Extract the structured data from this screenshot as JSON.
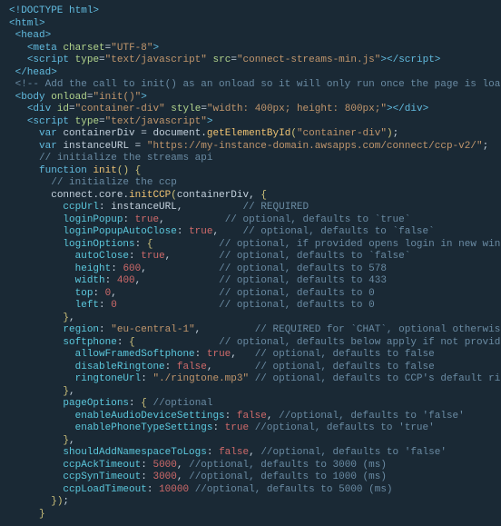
{
  "colors": {
    "bg": "#1a2935",
    "kw": "#62bce0",
    "attr": "#b2d48c",
    "str": "#c1966c",
    "val": "#cf6a6a",
    "fn": "#f0c373",
    "cmt": "#6a8ba3",
    "prop": "#5cc9de",
    "br": "#cdc17a",
    "plain": "#c5d2de"
  },
  "code": {
    "doctype": "<!DOCTYPE html>",
    "html_open": "<html>",
    "head_open": "<head>",
    "meta": {
      "charset": "UTF-8"
    },
    "script_ext": {
      "type": "text/javascript",
      "src": "connect-streams-min.js"
    },
    "head_close": "</head>",
    "add_call_comment": "<!-- Add the call to init() as an onload so it will only run once the page is loaded -->",
    "body_onload": "init()",
    "div": {
      "id": "container-div",
      "style": "width: 400px; height: 800px;"
    },
    "script_inline_type": "text/javascript",
    "var1": {
      "name": "containerDiv",
      "expr": "document.getElementById(\"container-div\");"
    },
    "var2": {
      "name": "instanceURL",
      "value": "\"https://my-instance-domain.awsapps.com/connect/ccp-v2/\""
    },
    "comment_streams": "// initialize the streams api",
    "fn_name": "init",
    "comment_ccp": "// initialize the ccp",
    "call": "connect.core.initCCP(containerDiv, ",
    "options": {
      "ccpUrl": {
        "v": "instanceURL",
        "c": "// REQUIRED"
      },
      "loginPopup": {
        "v": "true",
        "c": "// optional, defaults to `true`"
      },
      "loginPopupAutoClose": {
        "v": "true",
        "c": "// optional, defaults to `false`"
      },
      "loginOptions": {
        "comment": "// optional, if provided opens login in new window",
        "autoClose": {
          "v": "true",
          "c": "// optional, defaults to `false`"
        },
        "height": {
          "v": "600",
          "c": "// optional, defaults to 578"
        },
        "width": {
          "v": "400",
          "c": "// optional, defaults to 433"
        },
        "top": {
          "v": "0",
          "c": "// optional, defaults to 0"
        },
        "left": {
          "v": "0",
          "c": "// optional, defaults to 0"
        }
      },
      "region": {
        "v": "\"eu-central-1\"",
        "c": "// REQUIRED for `CHAT`, optional otherwise"
      },
      "softphone": {
        "comment": "// optional, defaults below apply if not provided",
        "allowFramedSoftphone": {
          "v": "true",
          "c": "// optional, defaults to false"
        },
        "disableRingtone": {
          "v": "false",
          "c": "// optional, defaults to false"
        },
        "ringtoneUrl": {
          "v": "\"./ringtone.mp3\"",
          "c": "// optional, defaults to CCP's default ringtone if a falsy value is s"
        }
      },
      "pageOptions": {
        "comment": "//optional",
        "enableAudioDeviceSettings": {
          "v": "false",
          "c": "//optional, defaults to 'false'"
        },
        "enablePhoneTypeSettings": {
          "v": "true",
          "c": "//optional, defaults to 'true'"
        }
      },
      "shouldAddNamespaceToLogs": {
        "v": "false",
        "c": "//optional, defaults to 'false'"
      },
      "ccpAckTimeout": {
        "v": "5000",
        "c": "//optional, defaults to 3000 (ms)"
      },
      "ccpSynTimeout": {
        "v": "3000",
        "c": "//optional, defaults to 1000 (ms)"
      },
      "ccpLoadTimeout": {
        "v": "10000",
        "c": "//optional, defaults to 5000 (ms)"
      }
    }
  }
}
